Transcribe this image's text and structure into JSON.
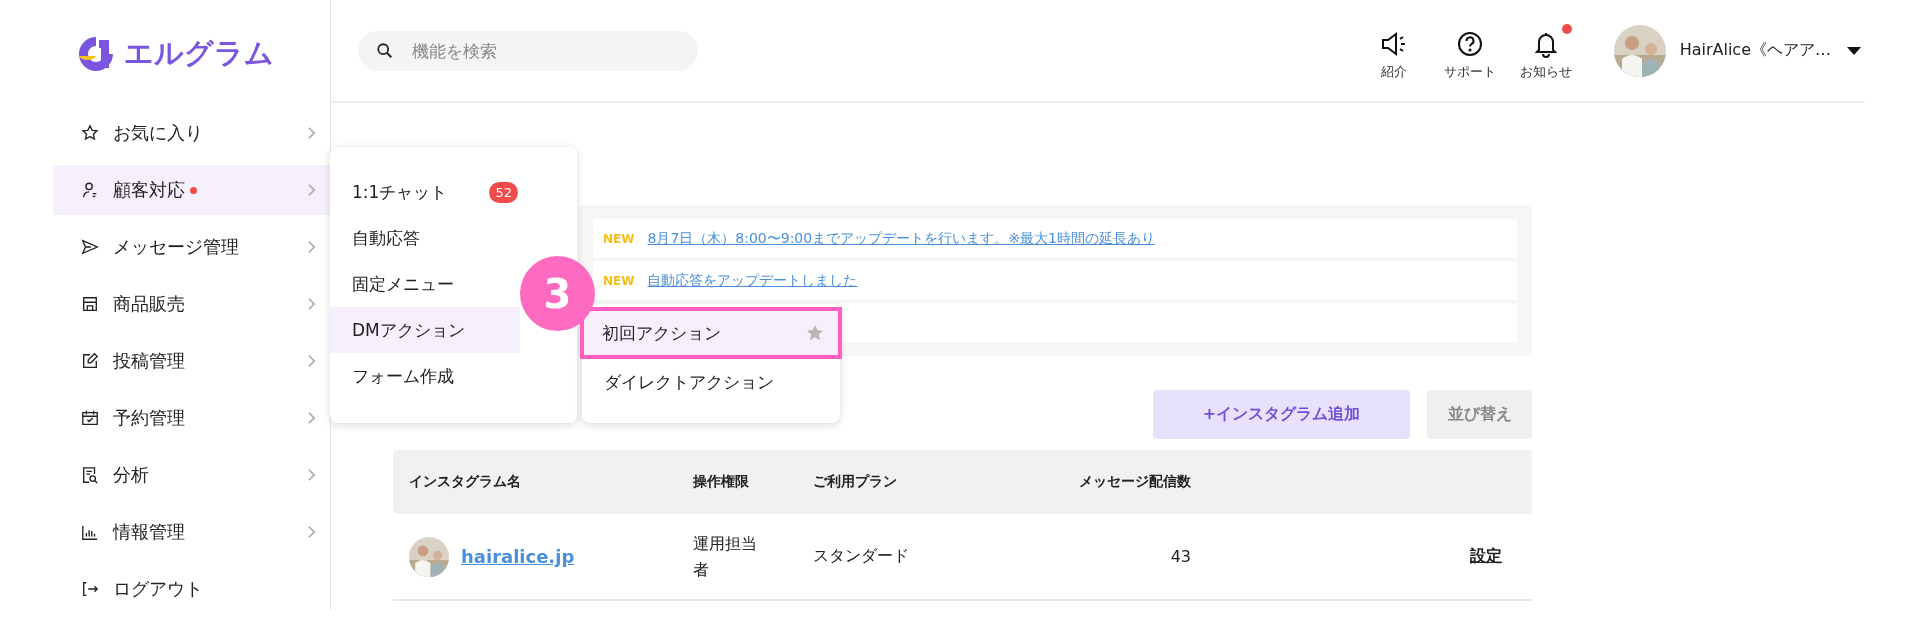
{
  "logo": {
    "text": "エルグラム"
  },
  "search": {
    "placeholder": "機能を検索"
  },
  "header_actions": [
    {
      "label": "紹介",
      "unread": false
    },
    {
      "label": "サポート",
      "unread": false
    },
    {
      "label": "お知らせ",
      "unread": true
    }
  ],
  "account": {
    "name": "HairAlice《ヘアア…"
  },
  "sidebar": {
    "items": [
      {
        "label": "お気に入り",
        "selected": false,
        "unread": false
      },
      {
        "label": "顧客対応",
        "selected": true,
        "unread": true
      },
      {
        "label": "メッセージ管理",
        "selected": false,
        "unread": false
      },
      {
        "label": "商品販売",
        "selected": false,
        "unread": false
      },
      {
        "label": "投稿管理",
        "selected": false,
        "unread": false
      },
      {
        "label": "予約管理",
        "selected": false,
        "unread": false
      },
      {
        "label": "分析",
        "selected": false,
        "unread": false
      },
      {
        "label": "情報管理",
        "selected": false,
        "unread": false
      },
      {
        "label": "ログアウト",
        "selected": false,
        "unread": false
      }
    ]
  },
  "menu": {
    "items": [
      {
        "label": "1:1チャット",
        "badge": "52",
        "selected": false
      },
      {
        "label": "自動応答",
        "selected": false
      },
      {
        "label": "固定メニュー",
        "selected": false
      },
      {
        "label": "DMアクション",
        "selected": true
      },
      {
        "label": "フォーム作成",
        "selected": false
      }
    ]
  },
  "submenu": {
    "items": [
      {
        "label": "初回アクション",
        "selected": true,
        "highlighted": true
      },
      {
        "label": "ダイレクトアクション",
        "selected": false,
        "highlighted": false
      }
    ]
  },
  "step_marker": {
    "label": "3"
  },
  "notices": [
    {
      "tag": "NEW",
      "text": "8月7日（木）8:00〜9:00までアップデートを行います。※最大1時間の延長あり"
    },
    {
      "tag": "NEW",
      "text": "自動応答をアップデートしました"
    }
  ],
  "buttons": [
    {
      "label": "+インスタグラム追加",
      "kind": "primary"
    },
    {
      "label": "並び替え",
      "kind": "secondary"
    }
  ],
  "table": {
    "columns": [
      "インスタグラム名",
      "操作権限",
      "ご利用プラン",
      "メッセージ配信数"
    ],
    "rows": [
      {
        "name": "hairalice.jp",
        "role": "運用担当者",
        "plan": "スタンダード",
        "messages": "43",
        "action": "設定"
      }
    ]
  }
}
